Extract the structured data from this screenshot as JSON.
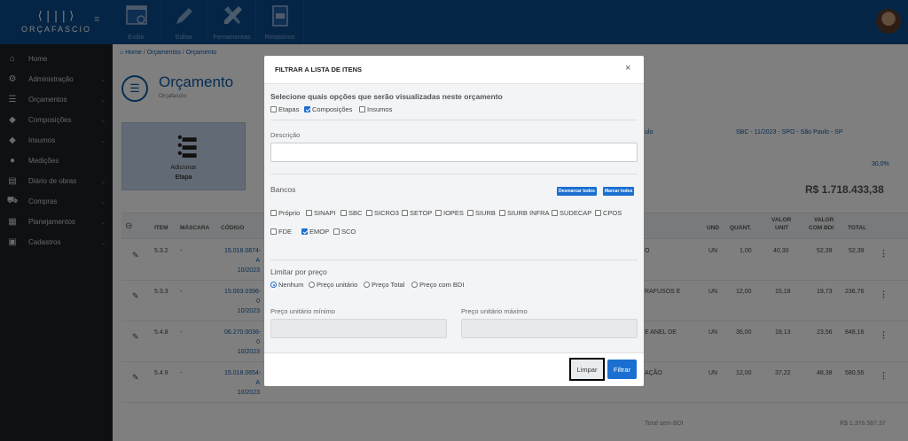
{
  "app": {
    "brand_mark": "⟨|||⟩",
    "brand_name": "ORÇAFASCIO"
  },
  "sidebar": {
    "items": [
      {
        "label": "Home",
        "icon": "home-icon"
      },
      {
        "label": "Administração",
        "icon": "gears-icon"
      },
      {
        "label": "Orçamentos",
        "icon": "list-icon"
      },
      {
        "label": "Composições",
        "icon": "eraser-icon"
      },
      {
        "label": "Insumos",
        "icon": "eraser-icon"
      },
      {
        "label": "Medições",
        "icon": "medal-icon"
      },
      {
        "label": "Diário de obras",
        "icon": "book-icon"
      },
      {
        "label": "Compras",
        "icon": "cart-icon"
      },
      {
        "label": "Planejamentos",
        "icon": "calendar-icon"
      },
      {
        "label": "Cadastros",
        "icon": "clipboard-icon"
      }
    ]
  },
  "toolbar": {
    "exibir": "Exibir",
    "editar": "Editar",
    "ferramentas": "Ferramentas",
    "relatorios": "Relatórios"
  },
  "breadcrumb": {
    "home": "Home",
    "orcamentos": "Orçamentos",
    "current": "Orçamento"
  },
  "page": {
    "title": "Orçamento",
    "subtitle": "Orçafascio"
  },
  "add_card": {
    "line1": "Adicionar",
    "line2": "Etapa"
  },
  "background": {
    "ulo": "ulo",
    "ref": "SBC - 11/2023 - SPO - São Paulo - SP",
    "percent": "30,0%",
    "total": "R$ 1.718.433,38",
    "footer_label": "Total sem BDI",
    "footer_value": "R$ 1.376.587,37"
  },
  "table": {
    "headers": {
      "item": "ITEM",
      "mascara": "MÁSCARA",
      "codigo": "CÓDIGO",
      "und": "UND",
      "quant": "QUANT.",
      "valor_unit_1": "VALOR",
      "valor_unit_2": "UNIT",
      "valor_bdi_1": "VALOR",
      "valor_bdi_2": "COM BDI",
      "total": "TOTAL"
    },
    "rows": [
      {
        "item": "5.3.2",
        "mascara": "-",
        "code1": "15.018.0874-",
        "code2": "A",
        "code3": "10/2023",
        "desc": "O",
        "und": "UN",
        "quant": "1,00",
        "unit": "40,30",
        "bdi": "52,39",
        "total": "52,39"
      },
      {
        "item": "5.3.3",
        "mascara": "-",
        "code1": "15.003.0396-",
        "code2": "0",
        "code3": "10/2023",
        "desc": "RAFUSOS E",
        "und": "UN",
        "quant": "12,00",
        "unit": "15,18",
        "bdi": "19,73",
        "total": "236,76"
      },
      {
        "item": "5.4.8",
        "mascara": "-",
        "code1": "06.270.0036-",
        "code2": "0",
        "code3": "10/2023",
        "desc": "E ANEL DE",
        "und": "UN",
        "quant": "36,00",
        "unit": "18,13",
        "bdi": "23,56",
        "total": "848,16"
      },
      {
        "item": "5.4.9",
        "mascara": "-",
        "code1": "15.018.0654-",
        "code2": "A",
        "code3": "10/2023",
        "desc": "AÇÃO",
        "und": "UN",
        "quant": "12,00",
        "unit": "37,22",
        "bdi": "48,38",
        "total": "580,56"
      }
    ]
  },
  "modal": {
    "title": "FILTRAR A LISTA DE ITENS",
    "close": "×",
    "options_title": "Selecione quais opções que serão visualizadas neste orçamento",
    "options": [
      {
        "label": "Etapas",
        "checked": false
      },
      {
        "label": "Composições",
        "checked": true
      },
      {
        "label": "Insumos",
        "checked": false
      }
    ],
    "descricao_label": "Descrição",
    "descricao_value": "",
    "bancos_title": "Bancos",
    "desmarcar_todos": "Desmarcar todos",
    "marcar_todos": "Marcar todos",
    "bancos_row1": [
      {
        "label": "Próprio",
        "checked": false
      },
      {
        "label": "SINAPI",
        "checked": false
      },
      {
        "label": "SBC",
        "checked": false
      },
      {
        "label": "SICRO3",
        "checked": false
      },
      {
        "label": "SETOP",
        "checked": false
      },
      {
        "label": "IOPES",
        "checked": false
      },
      {
        "label": "SIURB",
        "checked": false
      },
      {
        "label": "SIURB INFRA",
        "checked": false
      },
      {
        "label": "SUDECAP",
        "checked": false
      },
      {
        "label": "CPOS",
        "checked": false
      }
    ],
    "bancos_row2": [
      {
        "label": "FDE",
        "checked": false
      },
      {
        "label": "EMOP",
        "checked": true
      },
      {
        "label": "SCO",
        "checked": false
      }
    ],
    "preco_title": "Limitar por preço",
    "preco_options": [
      {
        "label": "Nenhum",
        "checked": true
      },
      {
        "label": "Preço unitário",
        "checked": false
      },
      {
        "label": "Preço Total",
        "checked": false
      },
      {
        "label": "Preço com BDI",
        "checked": false
      }
    ],
    "min_label": "Preço unitário mínimo",
    "max_label": "Preço unitário máximo",
    "limpar": "Limpar",
    "filtrar": "Filtrar"
  },
  "colors": {
    "brand": "#0a4a8c",
    "primary": "#1a6fd1",
    "sidebar": "#1d2329"
  }
}
